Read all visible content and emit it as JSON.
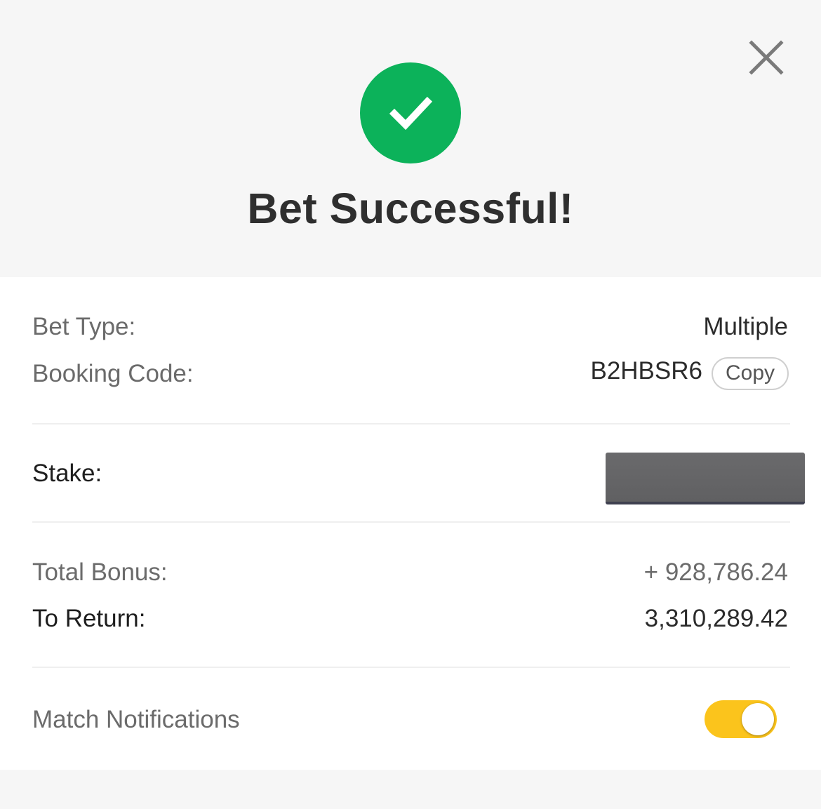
{
  "header": {
    "close_icon": "close-icon",
    "status_icon": "check-circle-icon",
    "status_color": "#0cb25a",
    "title": "Bet Successful!"
  },
  "details": {
    "bet_type_label": "Bet Type:",
    "bet_type_value": "Multiple",
    "booking_code_label": "Booking Code:",
    "booking_code_value": "B2HBSR6",
    "copy_label": "Copy",
    "stake_label": "Stake:",
    "total_bonus_label": "Total Bonus:",
    "total_bonus_value": "+ 928,786.24",
    "to_return_label": "To Return:",
    "to_return_value": "3,310,289.42"
  },
  "notifications": {
    "label": "Match Notifications",
    "enabled": true,
    "toggle_color": "#fbc41c"
  }
}
